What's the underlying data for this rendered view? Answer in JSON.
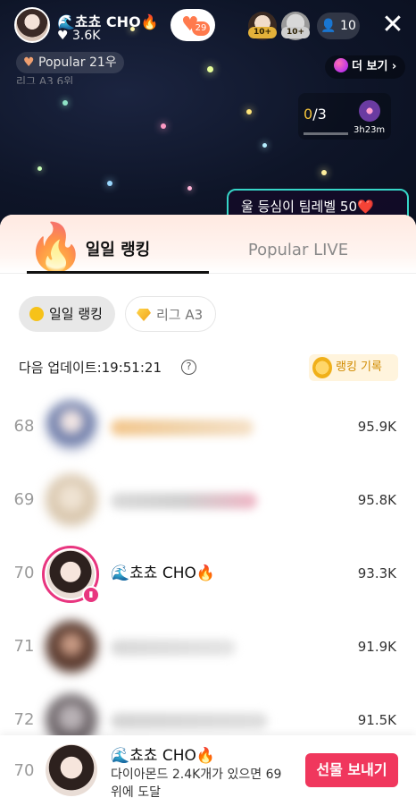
{
  "stream": {
    "host_name": "🌊쵸쵸 CHO🔥",
    "host_likes": "♥ 3.6K",
    "fan_badge_count": "29",
    "viewer_tags": [
      "10+",
      "10+"
    ],
    "viewer_count": "10",
    "popular_chip": "Popular 21우",
    "league_chip": "리그 A3 6위",
    "more_label": "더 보기 ›",
    "mission_done": "0",
    "mission_total": "/3",
    "mission_time": "3h23m",
    "banner_text": "울 등심이 팀레벨 50❤️"
  },
  "tabs": {
    "daily": "일일 랭킹",
    "popular_live": "Popular LIVE"
  },
  "filters": {
    "daily": "일일 랭킹",
    "league": "리그 A3"
  },
  "update": {
    "label": "다음 업데이트:19:51:21",
    "record_label": "랭킹 기록"
  },
  "rows": [
    {
      "rank": "68",
      "score": "95.9K"
    },
    {
      "rank": "69",
      "score": "95.8K"
    },
    {
      "rank": "70",
      "name": "🌊쵸쵸 CHO🔥",
      "score": "93.3K"
    },
    {
      "rank": "71",
      "score": "91.9K"
    },
    {
      "rank": "72",
      "score": "91.5K"
    }
  ],
  "self": {
    "rank": "70",
    "name": "🌊쵸쵸 CHO🔥",
    "message": "다이아몬드 2.4K개가 있으면 69위에 도달",
    "gift_button": "선물 보내기"
  },
  "colors": {
    "accent_pink": "#e8357f",
    "gift_red": "#f0375d",
    "gold": "#f6c21a"
  }
}
